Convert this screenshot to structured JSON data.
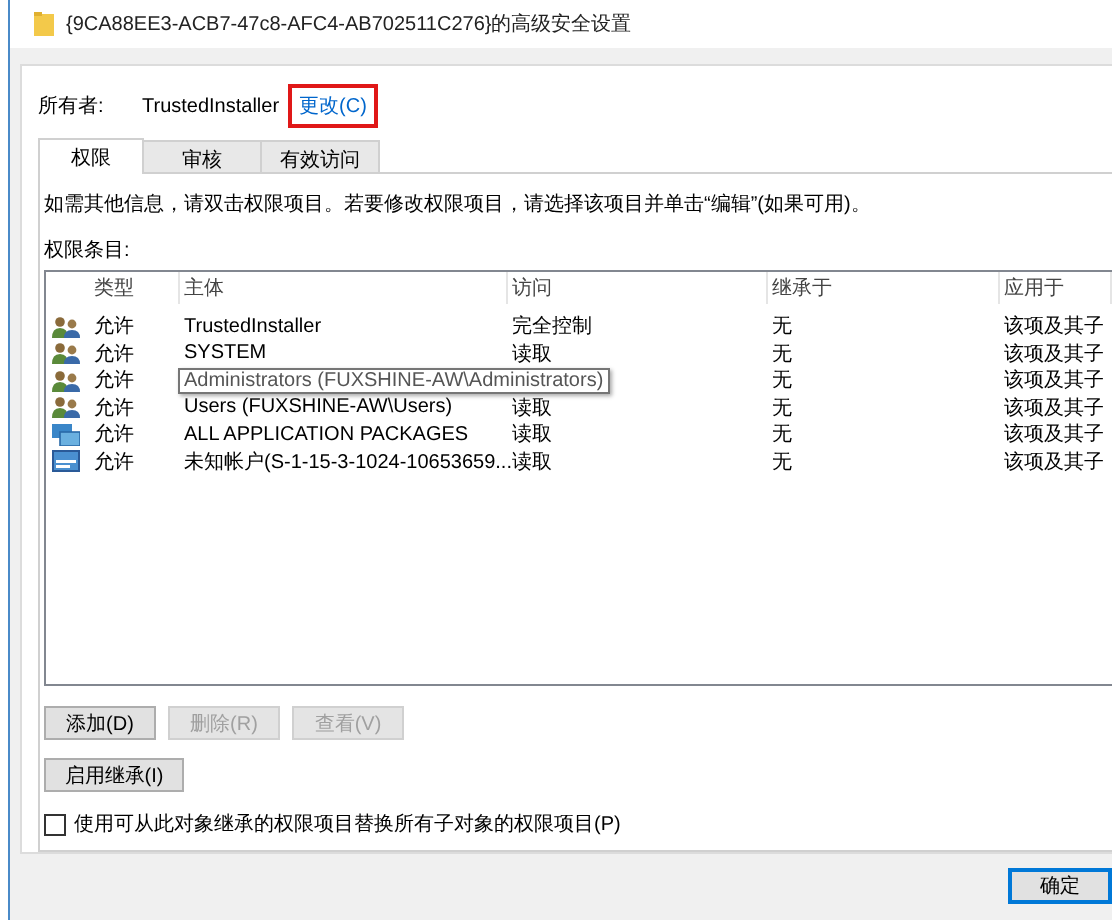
{
  "window": {
    "title": "{9CA88EE3-ACB7-47c8-AFC4-AB702511C276}的高级安全设置"
  },
  "owner": {
    "label": "所有者:",
    "value": "TrustedInstaller",
    "change_link": "更改(C)",
    "highlighted": true
  },
  "tabs": [
    {
      "label": "权限",
      "selected": true
    },
    {
      "label": "审核",
      "selected": false
    },
    {
      "label": "有效访问",
      "selected": false
    }
  ],
  "info_text": "如需其他信息，请双击权限项目。若要修改权限项目，请选择该项目并单击“编辑”(如果可用)。",
  "list_label": "权限条目:",
  "table": {
    "columns": [
      "类型",
      "主体",
      "访问",
      "继承于",
      "应用于"
    ],
    "rows": [
      {
        "kind": "user",
        "type": "允许",
        "principal": "TrustedInstaller",
        "access": "完全控制",
        "inherited_from": "无",
        "applies_to": "该项及其子",
        "tooltip": false
      },
      {
        "kind": "user",
        "type": "允许",
        "principal": "SYSTEM",
        "access": "读取",
        "inherited_from": "无",
        "applies_to": "该项及其子",
        "tooltip": false
      },
      {
        "kind": "user",
        "type": "允许",
        "principal": "Administrators (FUXSHINE-AW\\Administrators)",
        "inherited_from": "无",
        "applies_to": "该项及其子",
        "tooltip": true
      },
      {
        "kind": "user",
        "type": "允许",
        "principal": "Users (FUXSHINE-AW\\Users)",
        "access": "读取",
        "inherited_from": "无",
        "applies_to": "该项及其子",
        "tooltip": false
      },
      {
        "kind": "package",
        "type": "允许",
        "principal": "ALL APPLICATION PACKAGES",
        "access": "读取",
        "inherited_from": "无",
        "applies_to": "该项及其子",
        "tooltip": false
      },
      {
        "kind": "account",
        "type": "允许",
        "principal": "未知帐户(S-1-15-3-1024-10653659...",
        "access": "读取",
        "inherited_from": "无",
        "applies_to": "该项及其子",
        "tooltip": false
      }
    ]
  },
  "buttons": [
    {
      "label": "添加(D)",
      "disabled": false
    },
    {
      "label": "删除(R)",
      "disabled": true
    },
    {
      "label": "查看(V)",
      "disabled": true
    }
  ],
  "inherit_button": {
    "label": "启用继承(I)"
  },
  "replace_checkbox": {
    "label": "使用可从此对象继承的权限项目替换所有子对象的权限项目(P)",
    "checked": false
  },
  "ok_button": {
    "label": "确定"
  }
}
